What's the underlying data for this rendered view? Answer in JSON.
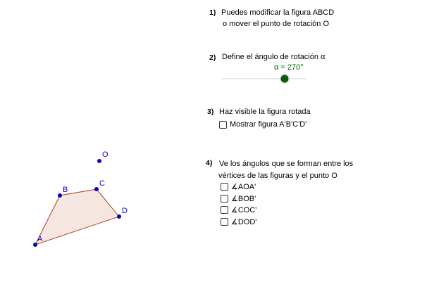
{
  "steps": [
    {
      "num": "1)",
      "line1": "Puedes modificar la figura ABCD",
      "line2": "o mover el punto de rotación O"
    },
    {
      "num": "2)",
      "line1": "Define el ángulo de rotación α"
    },
    {
      "num": "3)",
      "line1": "Haz visible la figura rotada"
    },
    {
      "num": "4)",
      "line1": "Ve los ángulos que se forman entre los",
      "line2": "vértices de las figuras y el punto O"
    }
  ],
  "slider": {
    "label": "α = 270°",
    "value_deg": 270
  },
  "show_figure_checkbox": {
    "label": "Mostrar figura A'B'C'D'",
    "checked": false
  },
  "angle_checkboxes": [
    {
      "label": "∡AOA'",
      "checked": false
    },
    {
      "label": "∡BOB'",
      "checked": false
    },
    {
      "label": "∡COC'",
      "checked": false
    },
    {
      "label": "∡DOD'",
      "checked": false
    }
  ],
  "points": {
    "A": "A",
    "B": "B",
    "C": "C",
    "D": "D",
    "O": "O"
  },
  "colors": {
    "polygon_fill": "#f5e6e1",
    "polygon_stroke": "#b5451b",
    "point": "#0000cc",
    "slider_knob": "#006400",
    "slider_track": "#c8d8d0"
  }
}
